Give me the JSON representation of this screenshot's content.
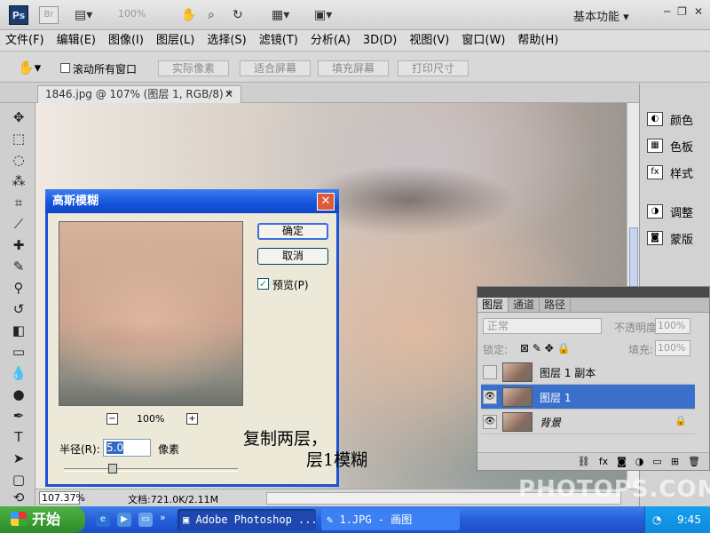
{
  "appbar": {
    "ps_logo": "Ps",
    "br_logo": "Br",
    "zoom": "100%",
    "workspace": "基本功能",
    "icons": [
      "camera-icon",
      "hand-icon",
      "zoom-icon",
      "rotate-icon",
      "layout-icon",
      "screen-mode-icon"
    ]
  },
  "menu": [
    "文件(F)",
    "编辑(E)",
    "图像(I)",
    "图层(L)",
    "选择(S)",
    "滤镜(T)",
    "分析(A)",
    "3D(D)",
    "视图(V)",
    "窗口(W)",
    "帮助(H)"
  ],
  "options": {
    "scroll_all_label": "滚动所有窗口",
    "buttons": [
      "实际像素",
      "适合屏幕",
      "填充屏幕",
      "打印尺寸"
    ]
  },
  "document": {
    "tab_title": "1846.jpg @ 107% (图层 1, RGB/8) *",
    "zoom": "107.37%",
    "doc_info": "文档:721.0K/2.11M"
  },
  "right_panel": {
    "items": [
      {
        "label": "颜色",
        "icon": "color-icon"
      },
      {
        "label": "色板",
        "icon": "swatches-icon"
      },
      {
        "label": "样式",
        "icon": "styles-icon"
      },
      {
        "label": "调整",
        "icon": "adjustments-icon"
      },
      {
        "label": "蒙版",
        "icon": "masks-icon"
      }
    ]
  },
  "layers_panel": {
    "tabs": [
      "图层",
      "通道",
      "路径"
    ],
    "blend_mode": "正常",
    "opacity_label": "不透明度:",
    "opacity_value": "100%",
    "lock_label": "锁定:",
    "fill_label": "填充:",
    "fill_value": "100%",
    "layers": [
      {
        "name": "图层 1 副本",
        "visible": false,
        "selected": false
      },
      {
        "name": "图层 1",
        "visible": true,
        "selected": true
      },
      {
        "name": "背景",
        "visible": true,
        "selected": false,
        "locked": true
      }
    ]
  },
  "dialog": {
    "title": "高斯模糊",
    "ok": "确定",
    "cancel": "取消",
    "preview_label": "预览(P)",
    "preview_checked": true,
    "zoom_percent": "100%",
    "radius_label": "半径(R):",
    "radius_value": "5.0",
    "radius_unit": "像素"
  },
  "annotation": {
    "line1": "复制两层，",
    "line2": "层1模糊"
  },
  "watermark": "PHOTOPS.COM",
  "taskbar": {
    "start": "开始",
    "tasks": [
      "Adobe Photoshop ...",
      "1.JPG - 画图"
    ],
    "time": "9:45"
  }
}
